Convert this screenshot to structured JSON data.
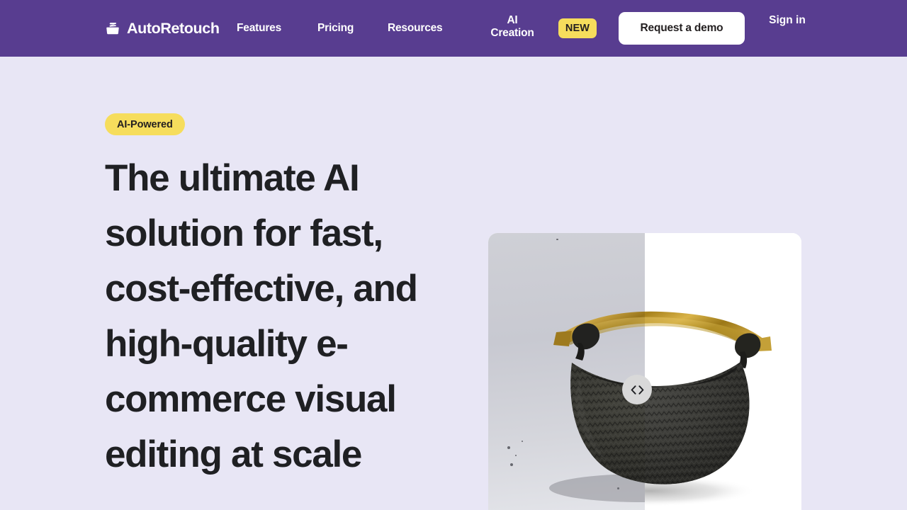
{
  "header": {
    "background_color": "#583D90",
    "brand": {
      "name": "AutoRetouch",
      "icon": "bag-logo-icon"
    },
    "nav": [
      {
        "label": "Features"
      },
      {
        "label": "Pricing"
      },
      {
        "label": "Resources"
      },
      {
        "label": "AI Creation"
      }
    ],
    "new_badge": {
      "label": "NEW",
      "color": "#F6DD5C"
    },
    "demo_button": {
      "label": "Request a demo"
    },
    "signin": {
      "label": "Sign in"
    }
  },
  "hero": {
    "eyebrow": {
      "label": "AI-Powered",
      "color": "#F6DD5C"
    },
    "headline": "The ultimate AI solution for fast, cost-effective, and high-quality e-commerce visual editing at scale",
    "headline_color": "#1F2023",
    "background_color": "#E8E6F5"
  },
  "compare": {
    "name": "before-after-image-comparison",
    "subject": "woven black leather handbag with gold metal handle",
    "before_label": "original photo on grey studio background",
    "after_label": "retouched photo on clean white background",
    "split_percent": 50,
    "handle_icon": "left-right-chevrons-icon"
  }
}
